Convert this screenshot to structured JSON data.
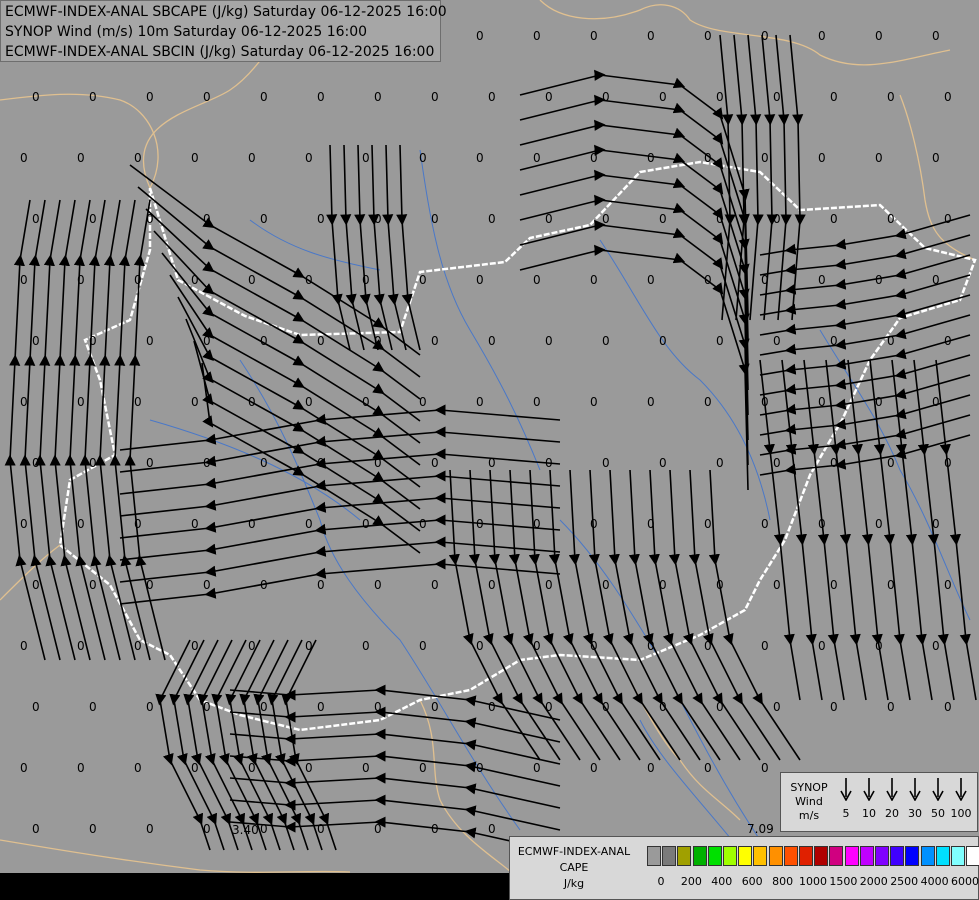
{
  "titles": {
    "line1": "ECMWF-INDEX-ANAL SBCAPE (J/kg) Saturday 06-12-2025 16:00",
    "line2": "SYNOP Wind (m/s) 10m Saturday 06-12-2025 16:00",
    "line3": "ECMWF-INDEX-ANAL SBCIN (J/kg) Saturday 06-12-2025 16:00"
  },
  "wind_legend": {
    "title_line1": "SYNOP",
    "title_line2": "Wind",
    "title_line3": "m/s",
    "speeds": [
      "5",
      "10",
      "20",
      "30",
      "50",
      "100"
    ]
  },
  "cape_legend": {
    "title_line1": "ECMWF-INDEX-ANAL",
    "title_line2": "CAPE",
    "title_line3": "J/kg",
    "colors": [
      "#9a9a9a",
      "#7a7a7a",
      "#a0a000",
      "#00b000",
      "#00e000",
      "#a0ff00",
      "#ffff00",
      "#ffc000",
      "#ff9000",
      "#ff5000",
      "#e02000",
      "#b00000",
      "#d00080",
      "#ff00ff",
      "#c000ff",
      "#8000ff",
      "#4000ff",
      "#0000ff",
      "#0090ff",
      "#00e0ff",
      "#80ffff",
      "#ffffff"
    ],
    "ticks": [
      "0",
      "200",
      "400",
      "600",
      "800",
      "1000",
      "1500",
      "2000",
      "2500",
      "4000",
      "6000"
    ]
  },
  "special_values": [
    "3.40",
    "7.09"
  ],
  "cin_value": "0",
  "colors": {
    "background": "#9a9a9a",
    "border_national": "#ffffff",
    "border_other": "#e0c090",
    "rivers": "#4a78c8",
    "streamlines": "#000000"
  }
}
